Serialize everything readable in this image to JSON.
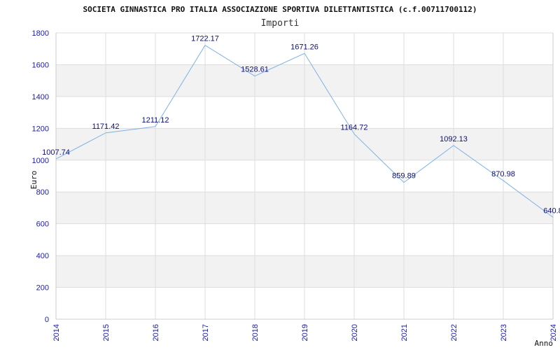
{
  "chart_data": {
    "type": "line",
    "title": "SOCIETA GINNASTICA PRO ITALIA ASSOCIAZIONE SPORTIVA DILETTANTISTICA (c.f.00711700112)",
    "subtitle": "Importi",
    "xlabel": "Anno",
    "ylabel": "Euro",
    "categories": [
      "2014",
      "2015",
      "2016",
      "2017",
      "2018",
      "2019",
      "2020",
      "2021",
      "2022",
      "2023",
      "2024"
    ],
    "series": [
      {
        "values": [
          1007.74,
          1171.42,
          1211.12,
          1722.17,
          1528.61,
          1671.26,
          1164.72,
          859.89,
          1092.13,
          870.98,
          640.8
        ],
        "labels": [
          "1007.74",
          "1171.42",
          "1211.12",
          "1722.17",
          "1528.61",
          "1671.26",
          "1164.72",
          "859.89",
          "1092.13",
          "870.98",
          "640.8"
        ]
      }
    ],
    "yticks": [
      "0",
      "200",
      "400",
      "600",
      "800",
      "1000",
      "1200",
      "1400",
      "1600",
      "1800"
    ],
    "ylim": [
      0,
      1800
    ],
    "grid": true,
    "colors": {
      "line": "#7fb2e5",
      "band": "#f2f2f2",
      "grid": "#dddddd",
      "tick_text": "#1a1aa6",
      "label_text": "#0d0d7a"
    }
  }
}
